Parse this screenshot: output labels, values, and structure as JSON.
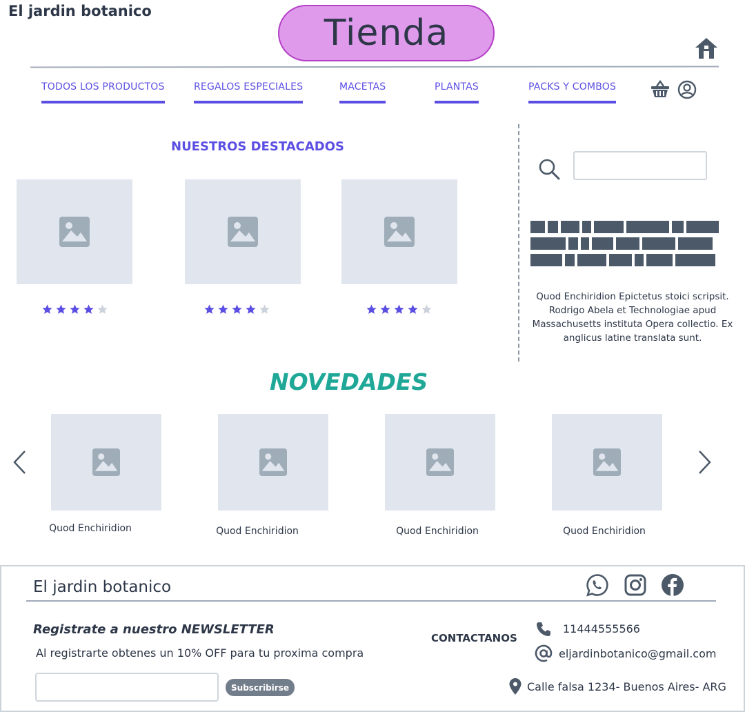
{
  "header": {
    "brand": "El jardin botanico",
    "page_title": "Tienda"
  },
  "nav": {
    "items": [
      {
        "label": "TODOS LOS PRODUCTOS"
      },
      {
        "label": "REGALOS ESPECIALES"
      },
      {
        "label": "MACETAS"
      },
      {
        "label": "PLANTAS"
      },
      {
        "label": "PACKS Y COMBOS"
      }
    ]
  },
  "featured": {
    "title": "NUESTROS DESTACADOS",
    "products": [
      {
        "rating": 4,
        "max_rating": 5
      },
      {
        "rating": 4,
        "max_rating": 5
      },
      {
        "rating": 4,
        "max_rating": 5
      }
    ]
  },
  "sidebar": {
    "search_placeholder": "",
    "text": "Quod Enchiridion Epictetus stoici scripsit. Rodrigo Abela et Technologiae apud Massachusetts instituta Opera collectio. Ex anglicus latine translata sunt."
  },
  "new_arrivals": {
    "title": "NOVEDADES",
    "items": [
      {
        "caption": "Quod Enchiridion"
      },
      {
        "caption": "Quod Enchiridion"
      },
      {
        "caption": "Quod Enchiridion"
      },
      {
        "caption": "Quod Enchiridion"
      }
    ]
  },
  "footer": {
    "brand": "El jardin botanico",
    "newsletter_title": "Registrate a nuestro NEWSLETTER",
    "newsletter_subtitle": "Al registrarte obtenes un 10% OFF para tu proxima compra",
    "email_placeholder": "",
    "subscribe_label": "Subscribirse",
    "contact_title": "CONTACTANOS",
    "phone": "11444555566",
    "email": "eljardinbotanico@gmail.com",
    "address": "Calle falsa 1234- Buenos Aires- ARG"
  },
  "colors": {
    "accent": "#5b4ee3",
    "teal": "#1fa897",
    "pill": "#df9aec",
    "pill_border": "#b33fc5",
    "dark": "#2d3748",
    "placeholder": "#e1e6ee",
    "icon": "#4c5968",
    "star_empty": "#cdd3dc"
  },
  "icons": {
    "header": [
      "home-icon",
      "cart-icon",
      "user-icon"
    ],
    "sidebar": [
      "search-icon"
    ],
    "carousel": [
      "chevron-left-icon",
      "chevron-right-icon"
    ],
    "social": [
      "whatsapp-icon",
      "instagram-icon",
      "facebook-icon"
    ],
    "contact": [
      "phone-icon",
      "at-icon",
      "location-pin-icon"
    ]
  }
}
